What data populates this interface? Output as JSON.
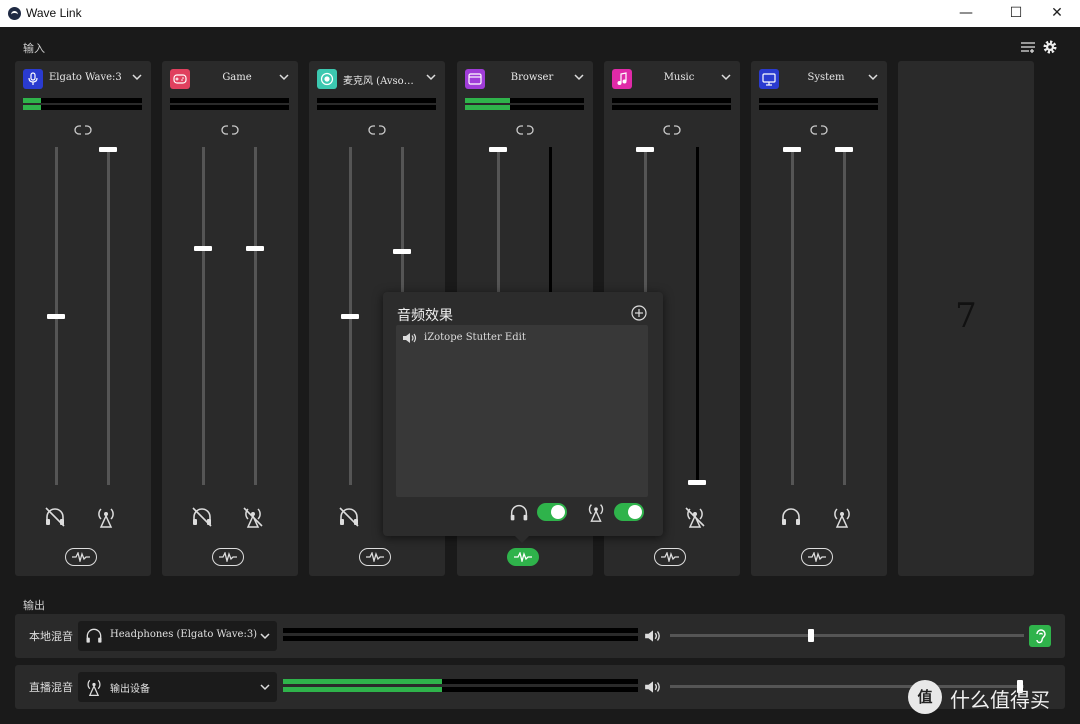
{
  "window": {
    "title": "Wave Link",
    "controls": {
      "minimize": "—",
      "maximize": "☐",
      "close": "✕"
    }
  },
  "inputs": {
    "section_label": "输入",
    "channels": [
      {
        "name": "Elgato Wave:3",
        "icon": "microphone-icon",
        "color": "#2a3bd0",
        "meter": [
          0.16,
          0.16
        ]
      },
      {
        "name": "Game",
        "icon": "gamepad-icon",
        "color": "#e0405e",
        "meter": [
          0,
          0
        ]
      },
      {
        "name": "麦克风 (Avso…",
        "icon": "record-icon",
        "color": "#3cc8b0",
        "meter": [
          0,
          0
        ]
      },
      {
        "name": "Browser",
        "icon": "browser-icon",
        "color": "#a03cd8",
        "meter": [
          0.38,
          0.38
        ]
      },
      {
        "name": "Music",
        "icon": "music-note-icon",
        "color": "#e02aa8",
        "meter": [
          0,
          0
        ]
      },
      {
        "name": "System",
        "icon": "monitor-icon",
        "color": "#2a3bd0",
        "meter": [
          0,
          0
        ]
      }
    ],
    "empty_slot_label": "7"
  },
  "effects_popup": {
    "title": "音频效果",
    "items": [
      {
        "name": "iZotope Stutter Edit"
      }
    ]
  },
  "outputs": {
    "section_label": "输出",
    "rows": [
      {
        "label": "本地混音",
        "device": "Headphones (Elgato Wave:3)",
        "icon": "headphones-icon",
        "meter": 0,
        "volume": 0.4
      },
      {
        "label": "直播混音",
        "device": "输出设备",
        "icon": "broadcast-icon",
        "meter": 0.45,
        "volume": 0.95
      }
    ]
  },
  "watermark": {
    "badge": "值",
    "text": "什么值得买"
  },
  "colors": {
    "accent": "#2fb34b",
    "panel": "#2a2a2a",
    "background": "#1a1a1a"
  }
}
